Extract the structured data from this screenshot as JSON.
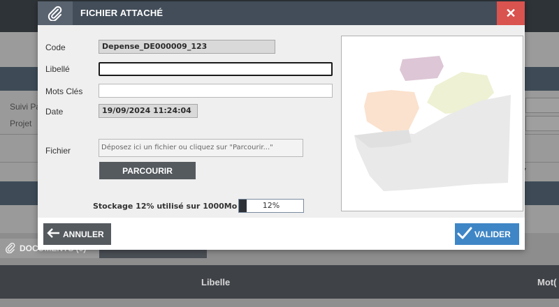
{
  "background": {
    "labels": {
      "suivi": "Suivi Pa",
      "projet": "Projet"
    },
    "tabs": {
      "documents": "DOCUMENTS (0)"
    },
    "table": {
      "col_libelle": "Libelle",
      "col_mot": "Mot("
    }
  },
  "modal": {
    "title": "FICHIER ATTACHÉ",
    "close_symbol": "✕",
    "fields": {
      "code": {
        "label": "Code",
        "value": "Depense_DE000009_123"
      },
      "libelle": {
        "label": "Libellé",
        "value": ""
      },
      "mots_cles": {
        "label": "Mots Clés",
        "value": ""
      },
      "date": {
        "label": "Date",
        "value": "19/09/2024 11:24:04"
      },
      "fichier": {
        "label": "Fichier",
        "placeholder": "Déposez ici un fichier ou cliquez sur \"Parcourir...\""
      }
    },
    "browse_label": "PARCOURIR",
    "storage": {
      "label": "Stockage 12% utilisé sur 1000Mo",
      "percent": 12,
      "percent_text": "12%"
    },
    "buttons": {
      "cancel": "ANNULER",
      "ok": "VALIDER"
    },
    "icons": {
      "header": "paperclip-icon",
      "cancel": "arrow-left-icon",
      "ok": "checkmark-icon",
      "preview": "placeholder-image-icon"
    },
    "colors": {
      "header_bg": "#424d59",
      "close_bg": "#d9534f",
      "ok_bg": "#3f86c6",
      "dark_btn_bg": "#555a5f"
    }
  }
}
